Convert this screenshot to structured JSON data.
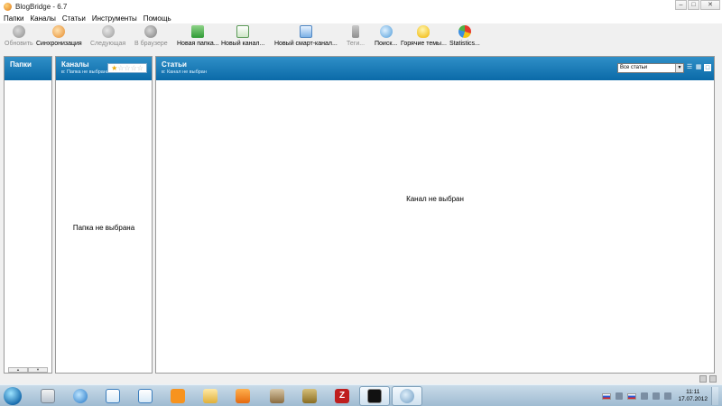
{
  "window": {
    "title": "BlogBridge - 6.7",
    "controls": {
      "minimize": "–",
      "maximize": "□",
      "close": "✕"
    }
  },
  "menu": [
    {
      "label": "Папки"
    },
    {
      "label": "Каналы"
    },
    {
      "label": "Статьи"
    },
    {
      "label": "Инструменты"
    },
    {
      "label": "Помощь"
    }
  ],
  "toolbar": [
    {
      "label": "Обновить",
      "icon": "refresh-icon",
      "enabled": false
    },
    {
      "label": "Синхронизация",
      "icon": "sync-icon",
      "enabled": true
    },
    {
      "label": "Следующая",
      "icon": "next-icon",
      "enabled": false
    },
    {
      "label": "В браузере",
      "icon": "browser-icon",
      "enabled": false
    },
    {
      "label": "Новая папка...",
      "icon": "new-folder-icon",
      "enabled": true
    },
    {
      "label": "Новый канал...",
      "icon": "new-channel-icon",
      "enabled": true
    },
    {
      "label": "Новый смарт-канал...",
      "icon": "smart-channel-icon",
      "enabled": true
    },
    {
      "label": "Теги...",
      "icon": "tags-icon",
      "enabled": false
    },
    {
      "label": "Поиск...",
      "icon": "search-icon",
      "enabled": true
    },
    {
      "label": "Горячие темы...",
      "icon": "hot-topics-icon",
      "enabled": true
    },
    {
      "label": "Statistics...",
      "icon": "statistics-icon",
      "enabled": true
    }
  ],
  "folders_panel": {
    "title": "Папки",
    "scroll_up": "▲",
    "scroll_down": "▼"
  },
  "channels_panel": {
    "title": "Каналы",
    "subtitle": "в: Папка не выбрана",
    "empty_message": "Папка не выбрана",
    "rating": {
      "filled": 1,
      "total": 5
    }
  },
  "articles_panel": {
    "title": "Статьи",
    "subtitle": "в: Канал не выбран",
    "empty_message": "Канал не выбран",
    "filter": {
      "selected": "Все статьи"
    }
  },
  "taskbar": {
    "apps": [
      {
        "name": "calculator-app",
        "icon": "calculator-icon"
      },
      {
        "name": "internet-explorer-app",
        "icon": "internet-explorer-icon"
      },
      {
        "name": "ie-window-app",
        "icon": "ie-window-icon"
      },
      {
        "name": "ie-window-2-app",
        "icon": "ie-window-icon"
      },
      {
        "name": "odnoklassniki-app",
        "icon": "odnoklassniki-icon"
      },
      {
        "name": "explorer-app",
        "icon": "folder-icon"
      },
      {
        "name": "media-player-app",
        "icon": "media-player-icon"
      },
      {
        "name": "gimp-app",
        "icon": "gimp-icon"
      },
      {
        "name": "tools-app",
        "icon": "tools-icon"
      },
      {
        "name": "filezilla-app",
        "icon": "filezilla-icon",
        "glyph": "Z"
      },
      {
        "name": "console-app",
        "icon": "console-icon"
      },
      {
        "name": "blogbridge-app",
        "icon": "blogbridge-icon"
      }
    ],
    "clock": {
      "time": "11:11",
      "date": "17.07.2012"
    }
  }
}
